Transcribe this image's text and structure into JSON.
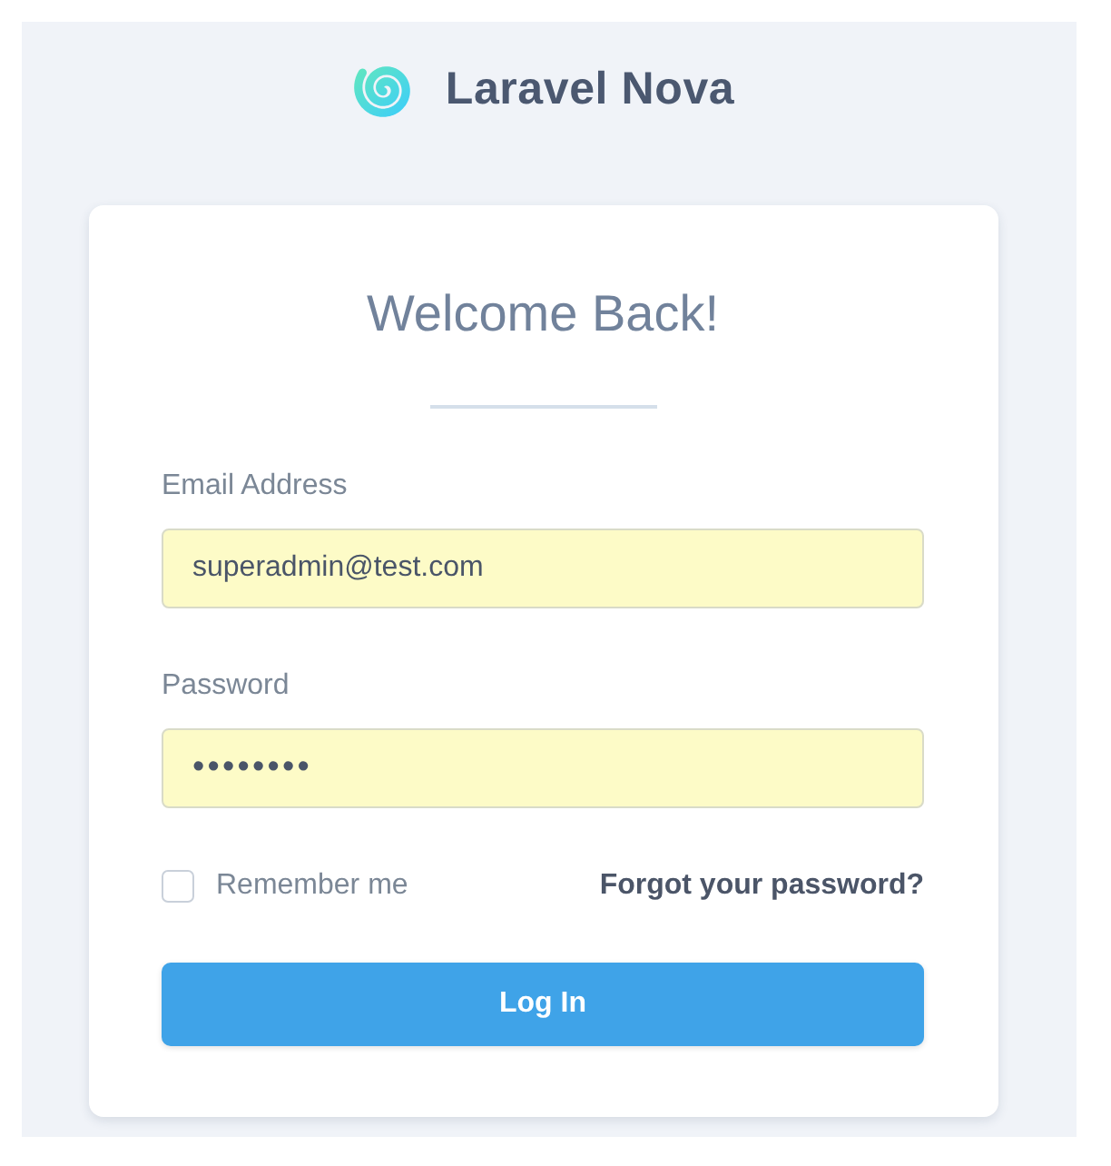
{
  "brand": {
    "name": "Laravel Nova"
  },
  "card": {
    "title": "Welcome Back!"
  },
  "fields": [
    {
      "kind": "email",
      "label": "Email Address",
      "value": "superadmin@test.com",
      "autofilled": true
    },
    {
      "kind": "password",
      "label": "Password",
      "value": "••••••••",
      "autofilled": true
    }
  ],
  "remember": {
    "label": "Remember me",
    "checked": false
  },
  "forgot_link": "Forgot your password?",
  "button": "Log In"
}
